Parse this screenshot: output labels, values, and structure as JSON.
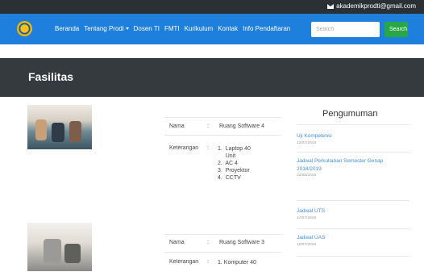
{
  "topbar": {
    "email": "akademikprodti@gmail.com",
    "icon": "envelope-icon"
  },
  "navbar": {
    "menu": [
      {
        "label": "Beranda"
      },
      {
        "label": "Tentang Prodi",
        "dropdown": true
      },
      {
        "label": "Dosen TI"
      },
      {
        "label": "FMTI"
      },
      {
        "label": "Kurikulum"
      },
      {
        "label": "Kontak"
      },
      {
        "label": "Info Pendaftaran"
      }
    ],
    "search_placeholder": "Search",
    "search_button": "Search"
  },
  "page": {
    "title": "Fasilitas"
  },
  "facilities": [
    {
      "name_label": "Nama",
      "sep": ":",
      "name": "Ruang Software 4",
      "desc_label": "Keterangan",
      "items": [
        "1.  Laptop 40",
        "     Unit",
        "2.  AC 4",
        "3.  Proyektor",
        "4.  CCTV"
      ]
    },
    {
      "name_label": "Nama",
      "sep": ":",
      "name": "Ruang Software 3",
      "desc_label": "Keterangan",
      "items": [
        "1. Komputer 40"
      ]
    }
  ],
  "announcements": {
    "title": "Pengumuman",
    "items": [
      {
        "title": "Uji Kompetensi",
        "date": "12/07/2019"
      },
      {
        "title": "Jadwal Perkuliahan Semester Genap 2018/2019",
        "date": "22/06/2019"
      },
      {
        "title": "Jadwal UTS",
        "date": "17/07/2019"
      },
      {
        "title": "Jadwal UAS",
        "date": "15/07/2019"
      }
    ]
  }
}
